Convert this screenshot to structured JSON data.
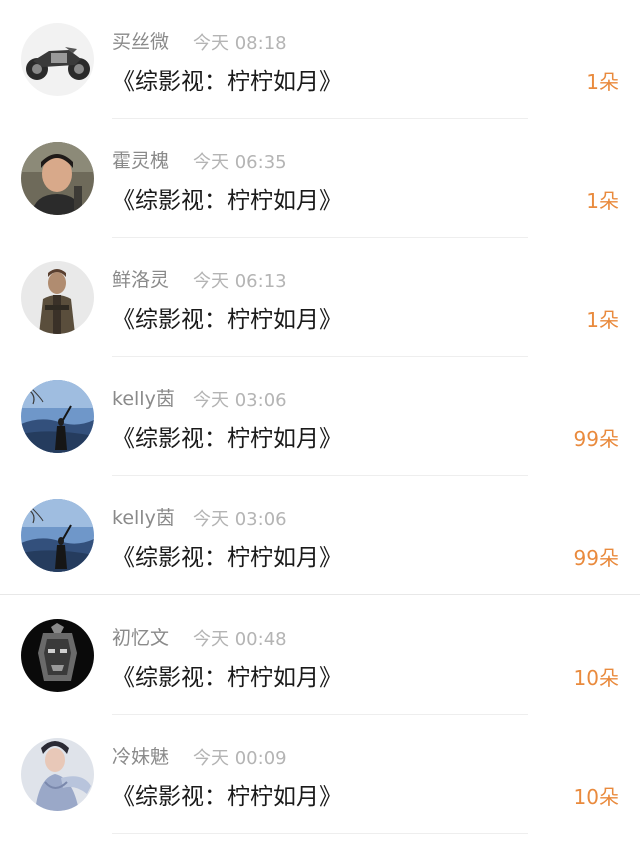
{
  "gift_list": {
    "items": [
      {
        "user": "买丝微",
        "time": "今天 08:18",
        "title": "《综影视：柠柠如月》",
        "amount": "1朵",
        "avatar": "motorcycle-avatar"
      },
      {
        "user": "霍灵槐",
        "time": "今天 06:35",
        "title": "《综影视：柠柠如月》",
        "amount": "1朵",
        "avatar": "person-photo-avatar"
      },
      {
        "user": "鲜洛灵",
        "time": "今天 06:13",
        "title": "《综影视：柠柠如月》",
        "amount": "1朵",
        "avatar": "game-character-avatar"
      },
      {
        "user": "kelly茵",
        "time": "今天 03:06",
        "title": "《综影视：柠柠如月》",
        "amount": "99朵",
        "avatar": "landscape-girl-avatar"
      },
      {
        "user": "kelly茵",
        "time": "今天 03:06",
        "title": "《综影视：柠柠如月》",
        "amount": "99朵",
        "avatar": "landscape-girl-avatar"
      },
      {
        "user": "初忆文",
        "time": "今天 00:48",
        "title": "《综影视：柠柠如月》",
        "amount": "10朵",
        "avatar": "dark-mask-avatar"
      },
      {
        "user": "冷妹魅",
        "time": "今天 00:09",
        "title": "《综影视：柠柠如月》",
        "amount": "10朵",
        "avatar": "costume-lady-avatar"
      }
    ]
  },
  "colors": {
    "amount": "#e98a3d",
    "username": "#8a8a8a",
    "timestamp": "#b4b4b4",
    "title": "#1a1a1a"
  }
}
